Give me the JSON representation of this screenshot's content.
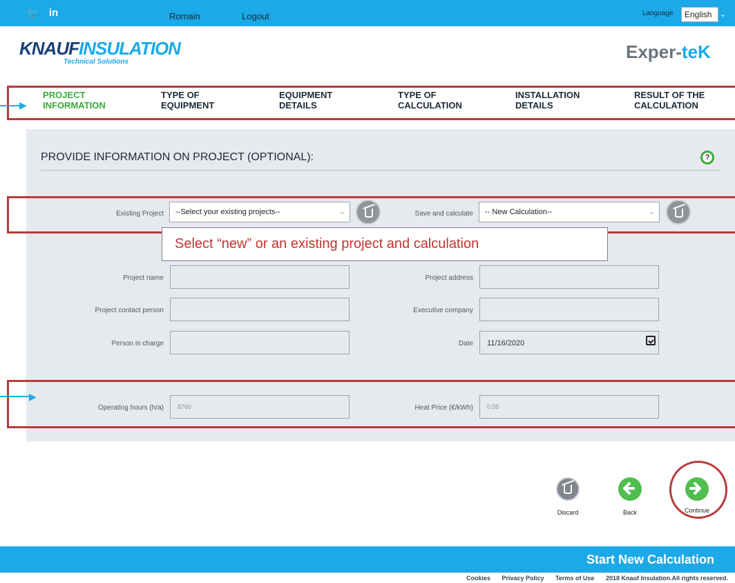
{
  "header": {
    "social": {
      "twitter": "twitter-icon",
      "linkedin": "in"
    },
    "user": "Romain",
    "logout": "Logout",
    "language_label": "Language",
    "language_value": "English"
  },
  "logo": {
    "part1": "KNAUF",
    "part2": "INSULATION",
    "sub": "Technical Solutions"
  },
  "brand": {
    "part1": "Exper-",
    "part2": "teK"
  },
  "steps": [
    {
      "line1": "PROJECT",
      "line2": "INFORMATION"
    },
    {
      "line1": "TYPE OF",
      "line2": "EQUIPMENT"
    },
    {
      "line1": "EQUIPMENT",
      "line2": "DETAILS"
    },
    {
      "line1": "TYPE OF",
      "line2": "CALCULATION"
    },
    {
      "line1": "INSTALLATION",
      "line2": "DETAILS"
    },
    {
      "line1": "RESULT OF THE",
      "line2": "CALCULATION"
    }
  ],
  "panel": {
    "title": "PROVIDE INFORMATION ON PROJECT (OPTIONAL):",
    "help": "?",
    "existing_project_label": "Existing Project",
    "existing_project_value": "--Select your existing projects--",
    "save_calc_label": "Save and calculate",
    "save_calc_value": "-- New Calculation--",
    "tooltip": "Select “new” or an existing project and calculation",
    "project_name_label": "Project name",
    "project_address_label": "Project address",
    "contact_label": "Project contact person",
    "exec_label": "Executive company",
    "person_label": "Person in charge",
    "date_label": "Date",
    "date_value": "11/16/2020",
    "hours_label": "Operating hours (h/a)",
    "hours_value": "8760",
    "price_label": "Heat Price (€/kWh)",
    "price_value": "0.05"
  },
  "actions": {
    "discard": "Discard",
    "back": "Back",
    "continue": "Continue"
  },
  "bottom": {
    "start_new": "Start New Calculation"
  },
  "footer": {
    "cookies": "Cookies",
    "privacy": "Privacy Policy",
    "terms": "Terms of Use",
    "copyright": "2018 Knauf Insulation.All rights reserved."
  },
  "colors": {
    "accent": "#1ba9e8",
    "highlight": "#b83a3a",
    "active": "#3aaa3a",
    "panel": "#e6e9ee"
  }
}
